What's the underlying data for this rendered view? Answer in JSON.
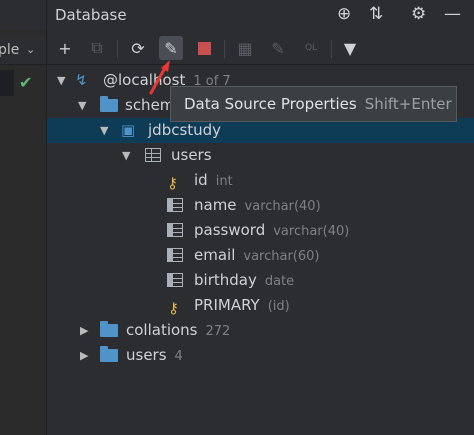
{
  "left": {
    "combo_text": "ple",
    "check": "✔"
  },
  "header": {
    "title": "Database"
  },
  "tooltip": {
    "label": "Data Source Properties",
    "shortcut": "Shift+Enter"
  },
  "tree": {
    "root": {
      "label": "@localhost",
      "meta": "1 of 7"
    },
    "schemas": {
      "label": "schem"
    },
    "db": {
      "label": "jdbcstudy"
    },
    "table": {
      "label": "users"
    },
    "columns": [
      {
        "name": "id",
        "type": "int"
      },
      {
        "name": "name",
        "type": "varchar(40)"
      },
      {
        "name": "password",
        "type": "varchar(40)"
      },
      {
        "name": "email",
        "type": "varchar(60)"
      },
      {
        "name": "birthday",
        "type": "date"
      }
    ],
    "key": {
      "name": "PRIMARY",
      "meta": "(id)"
    },
    "collations": {
      "label": "collations",
      "count": "272"
    },
    "users_folder": {
      "label": "users",
      "count": "4"
    }
  },
  "colors": {
    "accent": "#4f93c9",
    "selection": "#0e3b55",
    "stop": "#c94f4f"
  }
}
